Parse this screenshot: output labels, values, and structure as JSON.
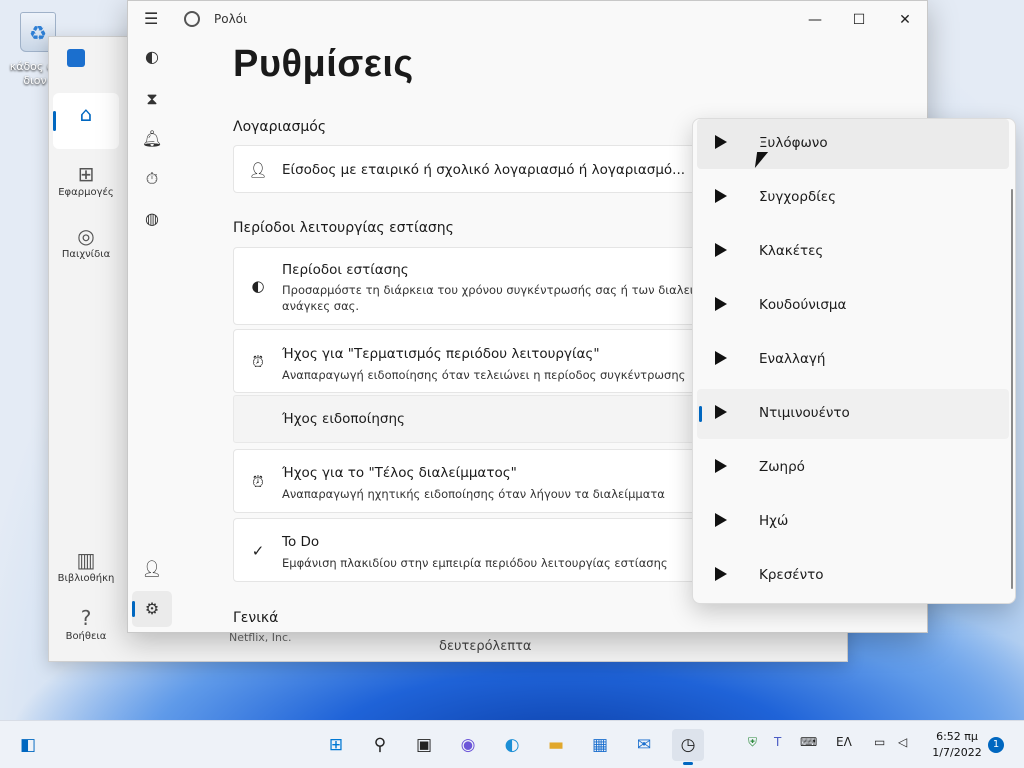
{
  "desktop": {
    "recycle_label_1": "κάδος αν",
    "recycle_label_2": "διον"
  },
  "store": {
    "nav": [
      {
        "icon": "home-icon",
        "label": ""
      },
      {
        "icon": "apps-icon",
        "label": "Εφαρμογές"
      },
      {
        "icon": "games-icon",
        "label": "Παιχνίδια"
      },
      {
        "icon": "library-icon",
        "label": "Βιβλιοθήκη"
      },
      {
        "icon": "help-icon",
        "label": "Βοήθεια"
      }
    ],
    "footer_publisher": "Netflix, Inc.",
    "footer_text": "δευτερόλεπτα"
  },
  "clock": {
    "app_title": "Ρολόι",
    "page_title": "Ρυθμίσεις",
    "account_header": "Λογαριασμός",
    "account_signin": "Είσοδος με εταιρικό ή σχολικό λογαριασμό ή λογαριασμό...",
    "focus_header": "Περίοδοι λειτουργίας εστίασης",
    "focus_periods_title": "Περίοδοι εστίασης",
    "focus_periods_desc_1": "Προσαρμόστε τη διάρκεια του χρόνου συγκέντρωσής σας ή των διαλειμμ",
    "focus_periods_desc_2": "ανάγκες σας.",
    "end_sound_title": "Ήχος για \"Τερματισμός περιόδου λειτουργίας\"",
    "end_sound_desc": "Αναπαραγωγή ειδοποίησης όταν τελειώνει η περίοδος συγκέντρωσης",
    "notif_sound_label": "Ήχος ειδοποίησης",
    "break_sound_title": "Ήχος για το \"Τέλος διαλείμματος\"",
    "break_sound_desc": "Αναπαραγωγή ηχητικής ειδοποίησης όταν λήγουν τα διαλείμματα",
    "todo_title": "To Do",
    "todo_desc": "Εμφάνιση πλακιδίου στην εμπειρία περιόδου λειτουργίας εστίασης",
    "general_header": "Γενικά"
  },
  "flyout": {
    "items": [
      {
        "label": "Ξυλόφωνο"
      },
      {
        "label": "Συγχορδίες"
      },
      {
        "label": "Κλακέτες"
      },
      {
        "label": "Κουδούνισμα"
      },
      {
        "label": "Εναλλαγή"
      },
      {
        "label": "Ντιμινουέντο"
      },
      {
        "label": "Ζωηρό"
      },
      {
        "label": "Ηχώ"
      },
      {
        "label": "Κρεσέντο"
      }
    ],
    "selected": "Ντιμινουέντο",
    "hovered": "Ξυλόφωνο"
  },
  "taskbar": {
    "language": "ΕΛ",
    "time": "6:52 πμ",
    "date": "1/7/2022",
    "notifications": "1"
  },
  "colors": {
    "accent": "#0067c0"
  }
}
